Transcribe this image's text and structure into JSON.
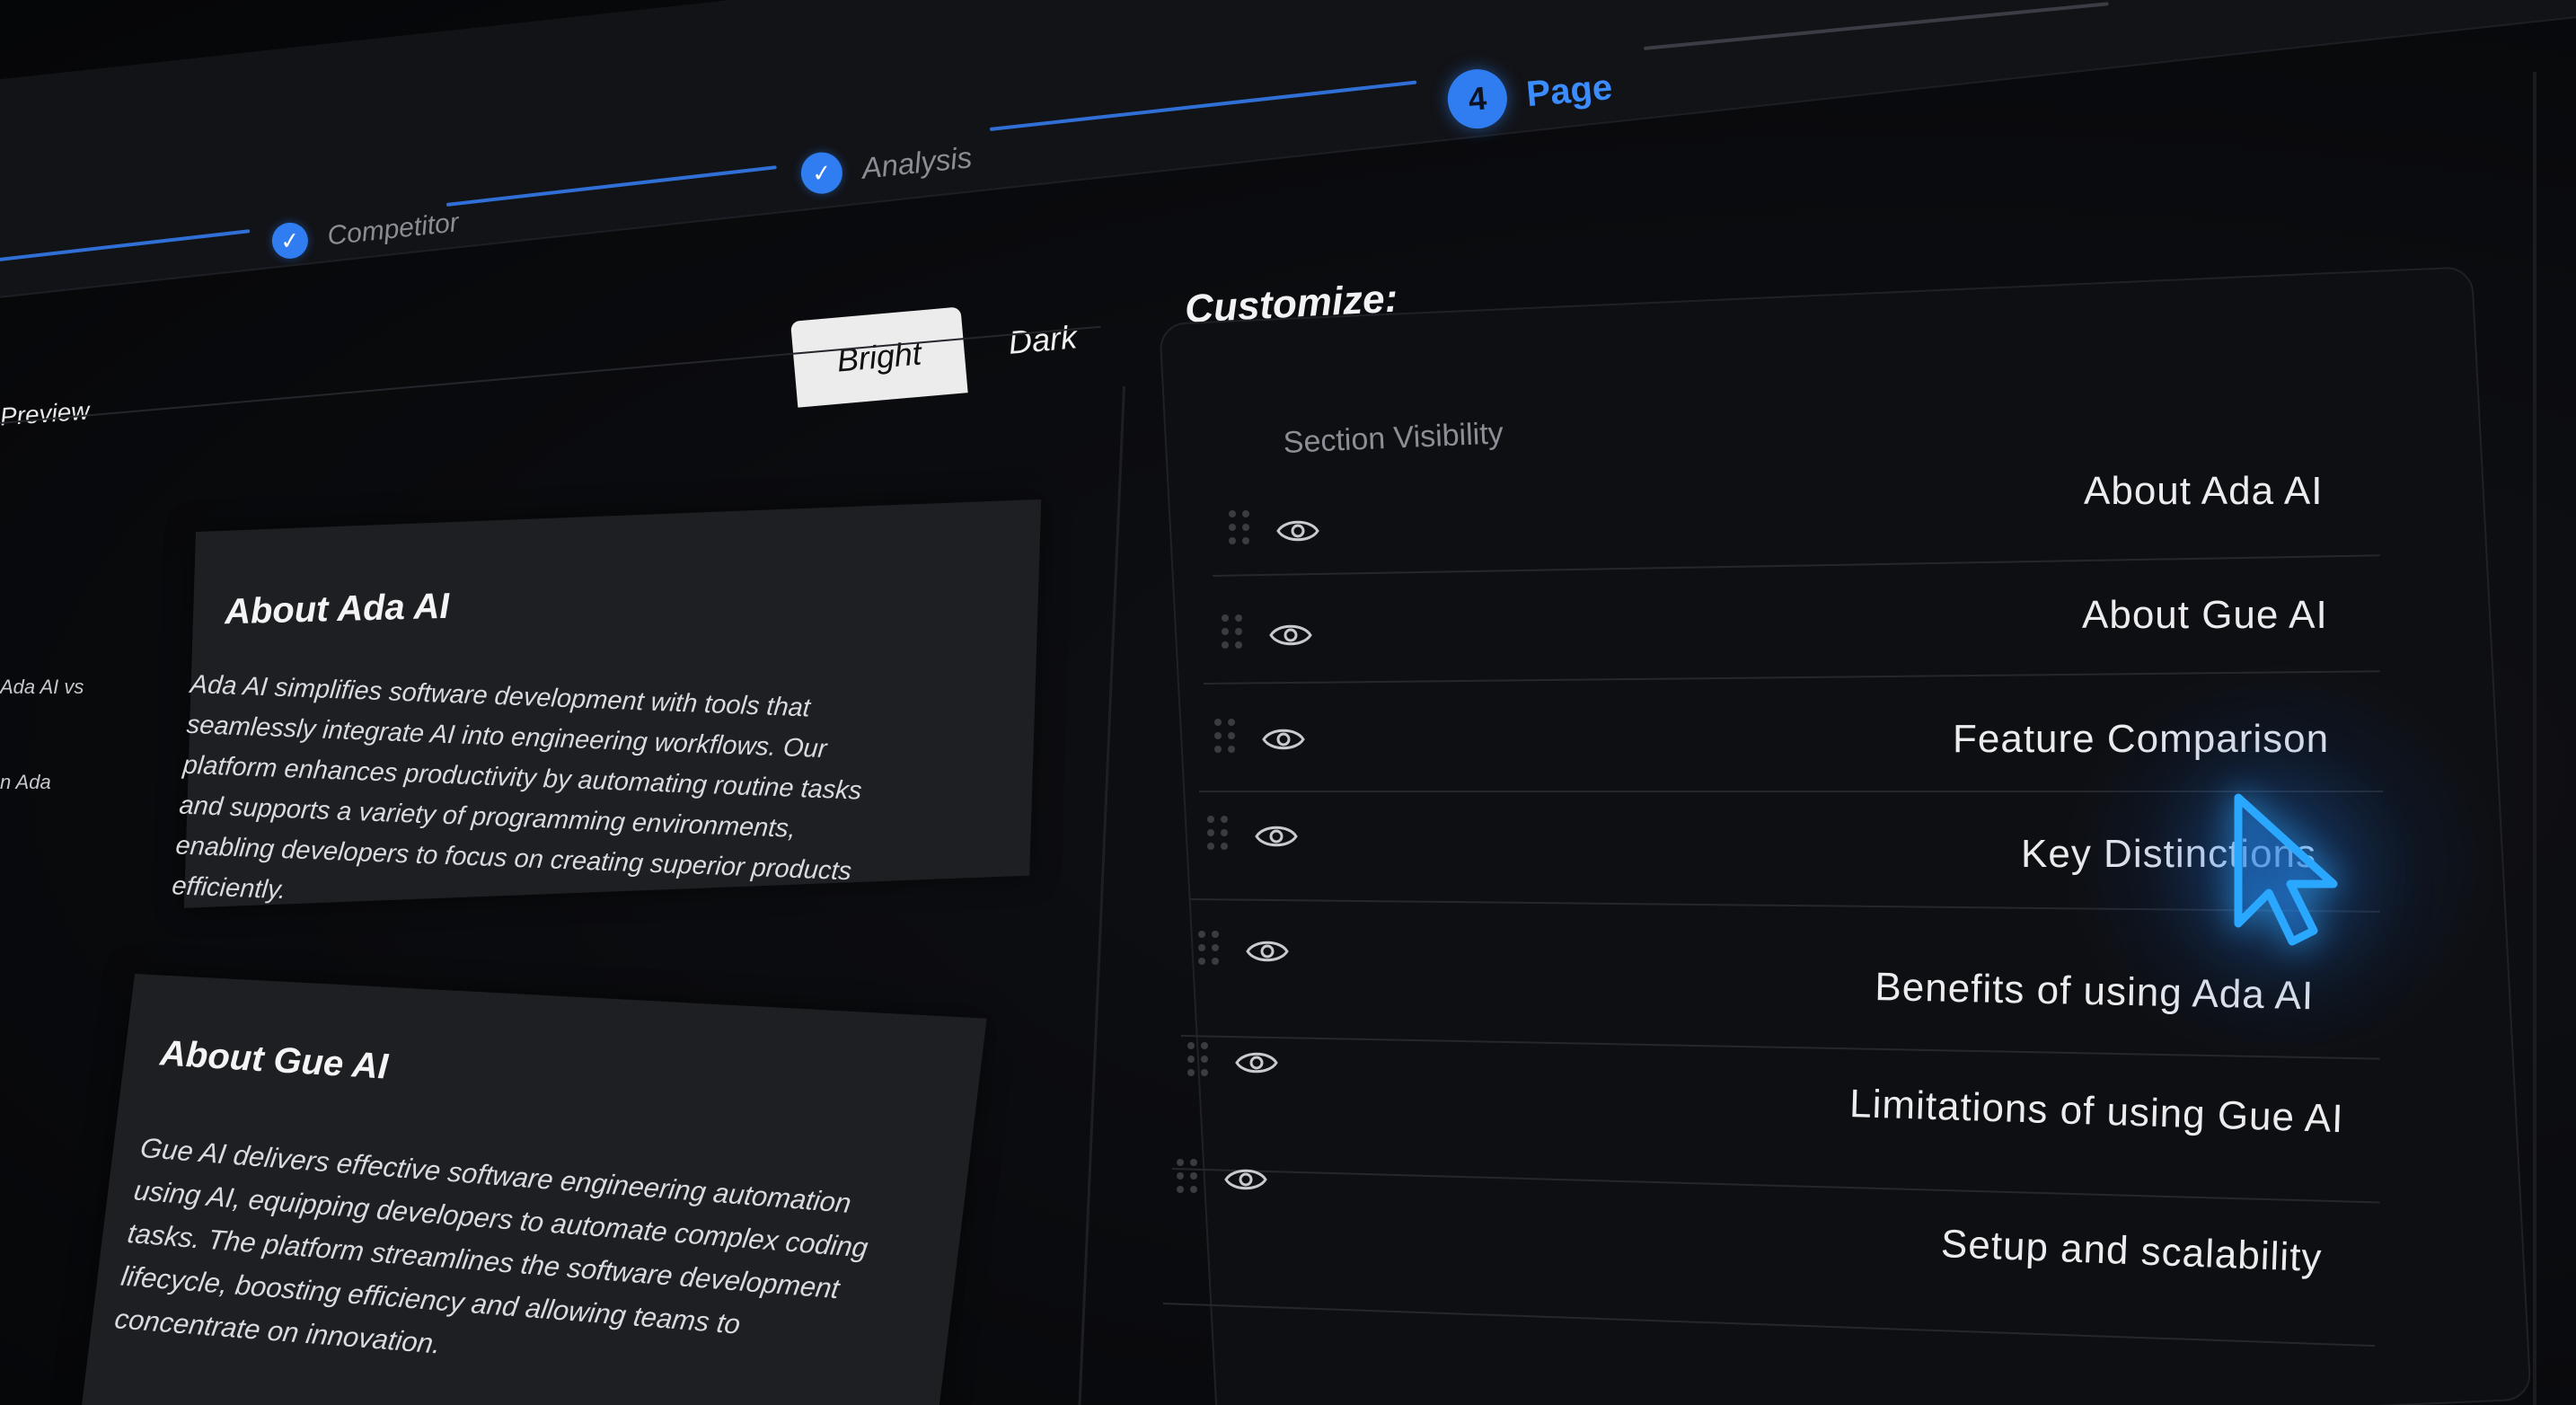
{
  "stepper": {
    "steps": [
      {
        "label": "Competitor",
        "state": "done"
      },
      {
        "label": "Analysis",
        "state": "done"
      },
      {
        "label": "Page",
        "state": "active",
        "number": "4"
      }
    ]
  },
  "preview": {
    "label": "Preview",
    "theme_toggle": {
      "bright": "Bright",
      "dark": "Dark",
      "selected": "Bright"
    },
    "side_snippets": [
      "Ada AI vs",
      "n Ada"
    ],
    "cards": [
      {
        "title": "About Ada AI",
        "body": "Ada AI simplifies software development with tools that seamlessly integrate AI into engineering workflows. Our platform enhances productivity by automating routine tasks and supports a variety of programming environments, enabling developers to focus on creating superior products efficiently."
      },
      {
        "title": "About Gue AI",
        "body": "Gue AI delivers effective software engineering automation using AI, equipping developers to automate complex coding tasks. The platform streamlines the software development lifecycle, boosting efficiency and allowing teams to concentrate on innovation."
      }
    ]
  },
  "customize": {
    "title": "Customize:",
    "section_visibility": "Section Visibility",
    "sections": [
      {
        "label": "About Ada AI",
        "visible": true
      },
      {
        "label": "About Gue AI",
        "visible": true
      },
      {
        "label": "Feature Comparison",
        "visible": true
      },
      {
        "label": "Key Distinctions",
        "visible": true
      },
      {
        "label": "Benefits of using Ada AI",
        "visible": true
      },
      {
        "label": "Limitations of using Gue AI",
        "visible": true
      },
      {
        "label": "Setup and scalability",
        "visible": true
      }
    ]
  },
  "colors": {
    "accent": "#2f7df0",
    "cursor": "#1e9bff",
    "background": "#0a0b0e",
    "card": "#1e1f22"
  },
  "icons": [
    "check-icon",
    "eye-icon",
    "drag-handle-icon",
    "cursor-arrow-icon"
  ]
}
